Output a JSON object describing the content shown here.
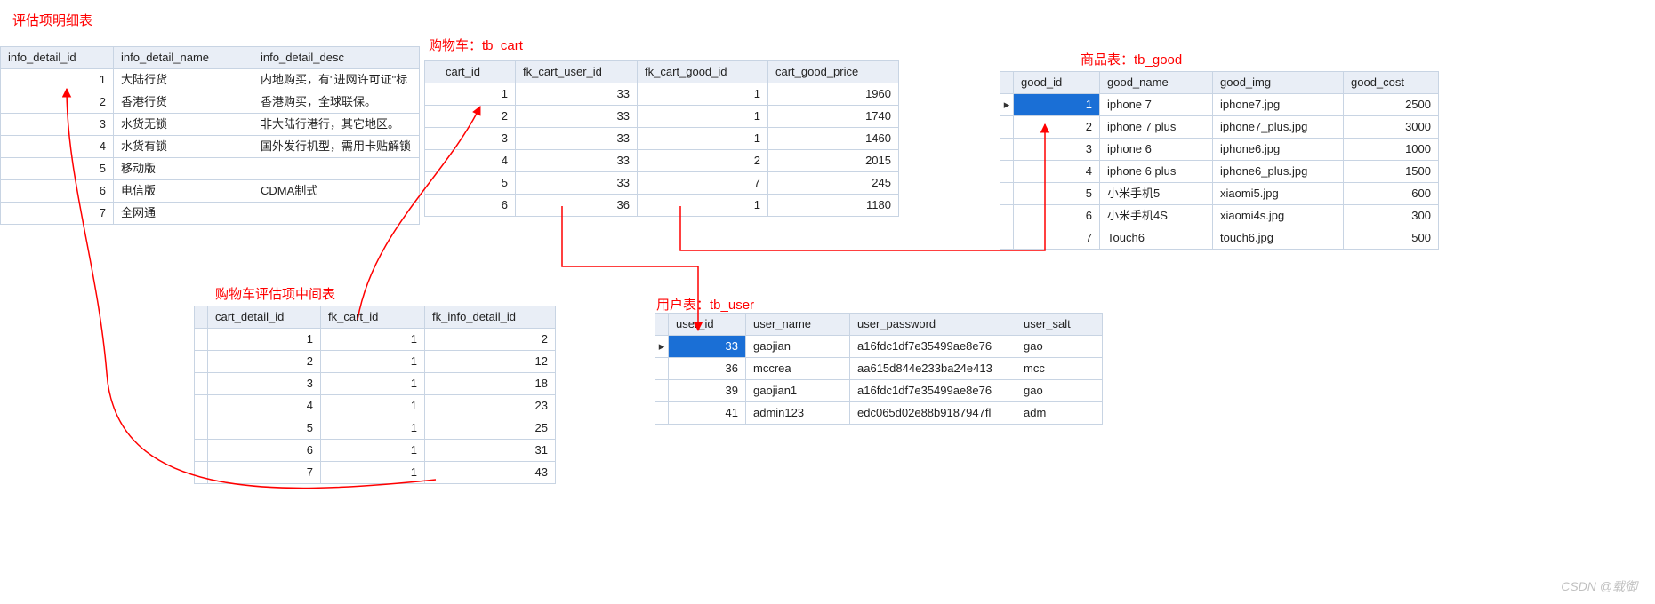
{
  "labels": {
    "info_detail": "评估项明细表",
    "cart": "购物车：tb_cart",
    "good": "商品表：tb_good",
    "cart_detail": "购物车评估项中间表",
    "user": "用户表：tb_user"
  },
  "watermark": "CSDN @载御",
  "tables": {
    "info_detail": {
      "columns": [
        "info_detail_id",
        "info_detail_name",
        "info_detail_desc"
      ],
      "rows": [
        [
          "1",
          "大陆行货",
          "内地购买，有\"进网许可证\"标"
        ],
        [
          "2",
          "香港行货",
          "香港购买，全球联保。"
        ],
        [
          "3",
          "水货无锁",
          "非大陆行港行，其它地区。"
        ],
        [
          "4",
          "水货有锁",
          "国外发行机型，需用卡贴解锁"
        ],
        [
          "5",
          "移动版",
          ""
        ],
        [
          "6",
          "电信版",
          "CDMA制式"
        ],
        [
          "7",
          "全网通",
          ""
        ]
      ]
    },
    "cart": {
      "columns": [
        "cart_id",
        "fk_cart_user_id",
        "fk_cart_good_id",
        "cart_good_price"
      ],
      "rows": [
        [
          "1",
          "33",
          "1",
          "1960"
        ],
        [
          "2",
          "33",
          "1",
          "1740"
        ],
        [
          "3",
          "33",
          "1",
          "1460"
        ],
        [
          "4",
          "33",
          "2",
          "2015"
        ],
        [
          "5",
          "33",
          "7",
          "245"
        ],
        [
          "6",
          "36",
          "1",
          "1180"
        ]
      ]
    },
    "good": {
      "columns": [
        "good_id",
        "good_name",
        "good_img",
        "good_cost"
      ],
      "rows": [
        [
          "1",
          "iphone 7",
          "iphone7.jpg",
          "2500"
        ],
        [
          "2",
          "iphone 7 plus",
          "iphone7_plus.jpg",
          "3000"
        ],
        [
          "3",
          "iphone 6",
          "iphone6.jpg",
          "1000"
        ],
        [
          "4",
          "iphone 6 plus",
          "iphone6_plus.jpg",
          "1500"
        ],
        [
          "5",
          "小米手机5",
          "xiaomi5.jpg",
          "600"
        ],
        [
          "6",
          "小米手机4S",
          "xiaomi4s.jpg",
          "300"
        ],
        [
          "7",
          "Touch6",
          "touch6.jpg",
          "500"
        ]
      ]
    },
    "cart_detail": {
      "columns": [
        "cart_detail_id",
        "fk_cart_id",
        "fk_info_detail_id"
      ],
      "rows": [
        [
          "1",
          "1",
          "2"
        ],
        [
          "2",
          "1",
          "12"
        ],
        [
          "3",
          "1",
          "18"
        ],
        [
          "4",
          "1",
          "23"
        ],
        [
          "5",
          "1",
          "25"
        ],
        [
          "6",
          "1",
          "31"
        ],
        [
          "7",
          "1",
          "43"
        ]
      ]
    },
    "user": {
      "columns": [
        "user_id",
        "user_name",
        "user_password",
        "user_salt"
      ],
      "rows": [
        [
          "33",
          "gaojian",
          "a16fdc1df7e35499ae8e76",
          "gao"
        ],
        [
          "36",
          "mccrea",
          "aa615d844e233ba24e413",
          "mcc"
        ],
        [
          "39",
          "gaojian1",
          "a16fdc1df7e35499ae8e76",
          "gao"
        ],
        [
          "41",
          "admin123",
          "edc065d02e88b9187947fl",
          "adm"
        ]
      ]
    }
  },
  "col_widths": {
    "info_detail": [
      110,
      140,
      170
    ],
    "cart": [
      70,
      120,
      130,
      130
    ],
    "good": [
      80,
      110,
      130,
      90
    ],
    "cart_detail": [
      110,
      100,
      130
    ],
    "user": [
      70,
      100,
      170,
      80
    ]
  },
  "numeric_cols": {
    "info_detail": [
      0
    ],
    "cart": [
      0,
      1,
      2,
      3
    ],
    "good": [
      0,
      3
    ],
    "cart_detail": [
      0,
      1,
      2
    ],
    "user": [
      0
    ]
  },
  "selected": {
    "info_detail": null,
    "cart": null,
    "good": {
      "row": 0,
      "col": 0
    },
    "cart_detail": null,
    "user": {
      "row": 0,
      "col": 0
    }
  },
  "pointer_col": {
    "info_detail": false,
    "cart": true,
    "good": true,
    "cart_detail": true,
    "user": true
  },
  "pointer_row": {
    "good": 0,
    "user": 0
  }
}
